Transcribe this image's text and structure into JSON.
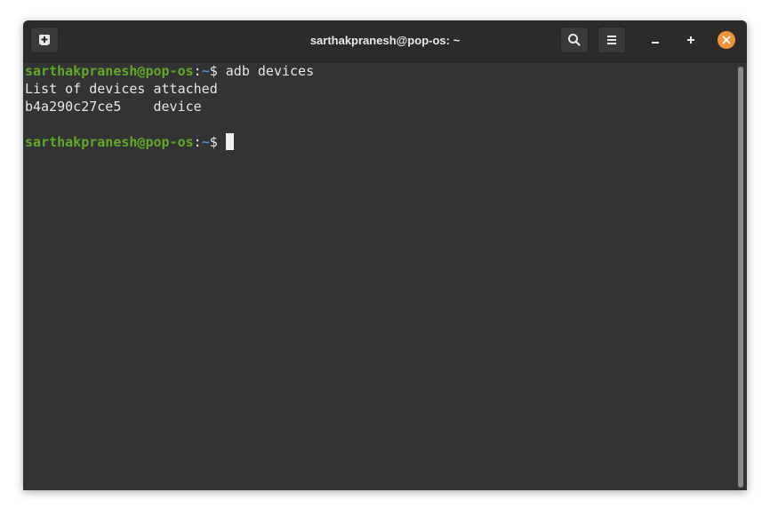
{
  "window": {
    "title": "sarthakpranesh@pop-os: ~"
  },
  "toolbar": {
    "new_tab_icon": "new-tab-icon",
    "search_icon": "search-icon",
    "menu_icon": "hamburger-menu-icon",
    "minimize_icon": "minimize-icon",
    "maximize_icon": "maximize-icon",
    "close_icon": "close-icon"
  },
  "terminal": {
    "prompt1": {
      "user_host": "sarthakpranesh@pop-os",
      "colon": ":",
      "path": "~",
      "dollar": "$ ",
      "command": "adb devices"
    },
    "output_line1": "List of devices attached",
    "output_line2": "b4a290c27ce5    device",
    "prompt2": {
      "user_host": "sarthakpranesh@pop-os",
      "colon": ":",
      "path": "~",
      "dollar": "$ "
    }
  },
  "colors": {
    "background": "#333333",
    "titlebar": "#2b2b2b",
    "user_host": "#5fa829",
    "path": "#4f8ed1",
    "text": "#e6e6e6",
    "close_button": "#f0923a"
  }
}
